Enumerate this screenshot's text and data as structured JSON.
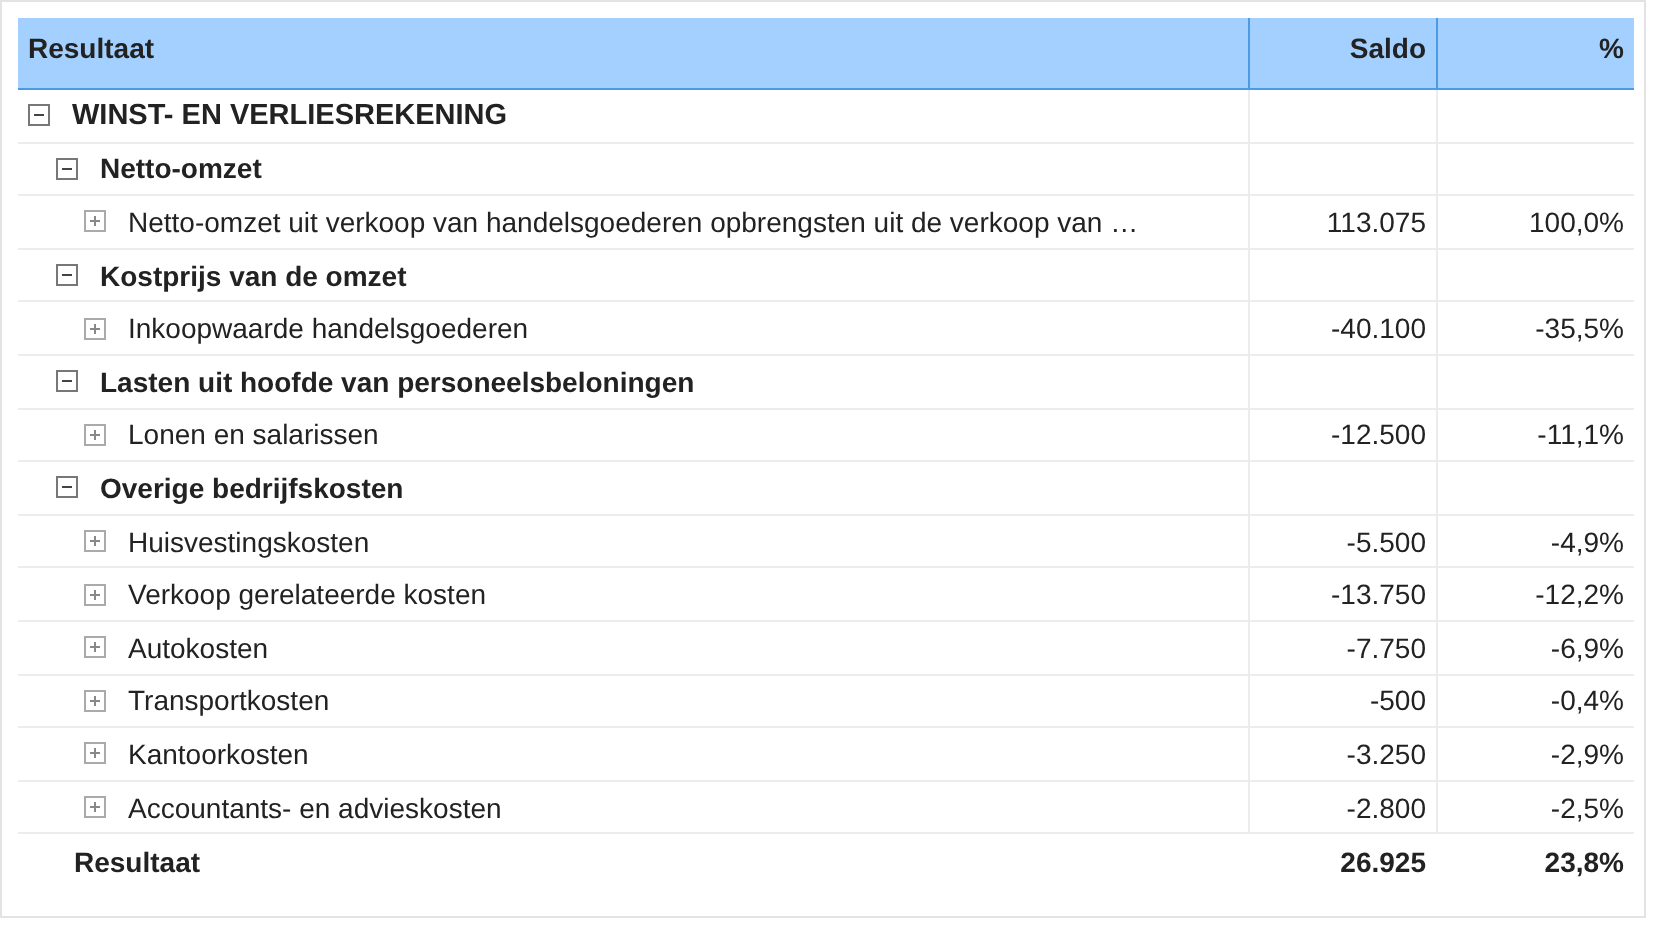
{
  "table": {
    "columns": [
      "Resultaat",
      "Saldo",
      "%"
    ],
    "rows": [
      {
        "label": "WINST- EN VERLIESREKENING",
        "expanded": true,
        "children": [
          {
            "label": "Netto-omzet",
            "expanded": true,
            "children": [
              {
                "label": "Netto-omzet uit verkoop van handelsgoederen opbrengsten uit de verkoop van …",
                "expanded": false,
                "saldo": "113.075",
                "percent": "100,0%"
              }
            ]
          },
          {
            "label": "Kostprijs van de omzet",
            "expanded": true,
            "children": [
              {
                "label": "Inkoopwaarde handelsgoederen",
                "expanded": false,
                "saldo": "-40.100",
                "percent": "-35,5%"
              }
            ]
          },
          {
            "label": "Lasten uit hoofde van personeelsbeloningen",
            "expanded": true,
            "children": [
              {
                "label": "Lonen en salarissen",
                "expanded": false,
                "saldo": "-12.500",
                "percent": "-11,1%"
              }
            ]
          },
          {
            "label": "Overige bedrijfskosten",
            "expanded": true,
            "children": [
              {
                "label": "Huisvestingskosten",
                "expanded": false,
                "saldo": "-5.500",
                "percent": "-4,9%"
              },
              {
                "label": "Verkoop gerelateerde kosten",
                "expanded": false,
                "saldo": "-13.750",
                "percent": "-12,2%"
              },
              {
                "label": "Autokosten",
                "expanded": false,
                "saldo": "-7.750",
                "percent": "-6,9%"
              },
              {
                "label": "Transportkosten",
                "expanded": false,
                "saldo": "-500",
                "percent": "-0,4%"
              },
              {
                "label": "Kantoorkosten",
                "expanded": false,
                "saldo": "-3.250",
                "percent": "-2,9%"
              },
              {
                "label": "Accountants- en advieskosten",
                "expanded": false,
                "saldo": "-2.800",
                "percent": "-2,5%"
              }
            ]
          }
        ]
      }
    ],
    "total": {
      "label": "Resultaat",
      "saldo": "26.925",
      "percent": "23,8%"
    }
  }
}
